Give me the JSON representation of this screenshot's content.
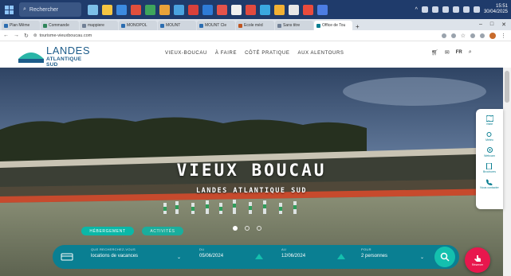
{
  "taskbar": {
    "search_placeholder": "Rechercher",
    "clock_time": "15:51",
    "clock_date": "30/04/2025"
  },
  "browser": {
    "tabs": [
      {
        "label": "Plan Même",
        "color": "#2b6cb0"
      },
      {
        "label": "Commande",
        "color": "#2f855a"
      },
      {
        "label": "mappiere",
        "color": "#718096"
      },
      {
        "label": "MONOPOL",
        "color": "#2b6cb0"
      },
      {
        "label": "MOUNT",
        "color": "#2b6cb0"
      },
      {
        "label": "MOUNT Cle",
        "color": "#2b6cb0"
      },
      {
        "label": "Ecole mèd",
        "color": "#c05621"
      },
      {
        "label": "Sans titre",
        "color": "#718096"
      },
      {
        "label": "Office de Tou",
        "color": "#0a7f92",
        "active": true
      }
    ],
    "url": "tourisme-vieuxboucau.com"
  },
  "site": {
    "logo_line1": "LANDES",
    "logo_line2": "ATLANTIQUE SUD",
    "nav": [
      "VIEUX-BOUCAU",
      "À FAIRE",
      "CÔTÉ PRATIQUE",
      "AUX ALENTOURS"
    ],
    "lang": "FR"
  },
  "hero": {
    "title": "VIEUX BOUCAU",
    "subtitle": "LANDES ATLANTIQUE SUD",
    "pills": [
      "HÉBERGEMENT",
      "ACTIVITÉS"
    ]
  },
  "search": {
    "type_label": "QUE RECHERCHEZ-VOUS",
    "type_value": "locations de vacances",
    "from_label": "DU",
    "from_value": "05/06/2024",
    "to_label": "AU",
    "to_value": "12/06/2024",
    "people_label": "POUR",
    "people_value": "2 personnes"
  },
  "sidebar": [
    "Visite",
    "Météo",
    "Webcam",
    "Brochures",
    "Nous contacter"
  ],
  "fab_label": "Réserver"
}
